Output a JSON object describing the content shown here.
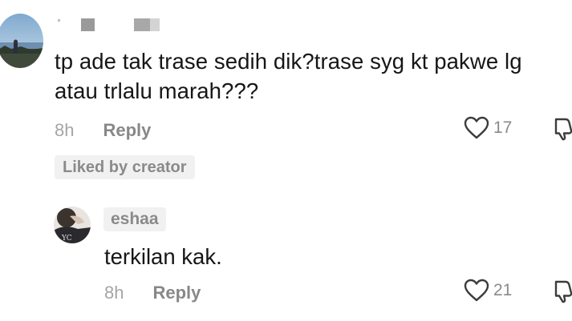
{
  "comment": {
    "text": "tp ade tak trase sedih dik?trase syg kt pakwe lg atau trlalu marah???",
    "time": "8h",
    "reply_label": "Reply",
    "like_count": "17",
    "liked_badge": "Liked by creator"
  },
  "reply": {
    "username": "eshaa",
    "text": "terkilan kak.",
    "time": "8h",
    "reply_label": "Reply",
    "like_count": "21"
  },
  "icons": {
    "like": "heart-outline-icon",
    "dislike": "thumbs-down-outline-icon"
  }
}
